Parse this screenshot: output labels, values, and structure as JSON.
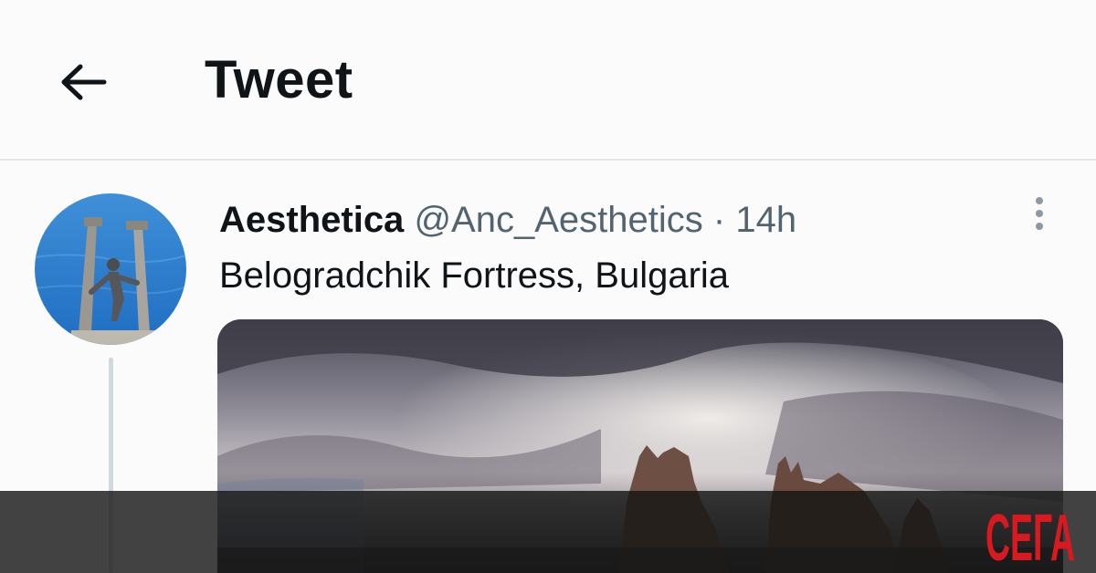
{
  "header": {
    "title": "Tweet",
    "back_icon": "arrow-left-icon"
  },
  "tweet": {
    "display_name": "Aesthetica",
    "handle": "@Anc_Aesthetics",
    "separator": "·",
    "time": "14h",
    "text": "Belogradchik Fortress, Bulgaria",
    "more_icon": "more-vertical-icon"
  },
  "watermark": {
    "text": "СЕГА",
    "color": "#d71920"
  },
  "colors": {
    "text": "#0f1419",
    "secondary": "#536471",
    "divider": "#e4e6e8",
    "thread": "#cfd9de"
  }
}
